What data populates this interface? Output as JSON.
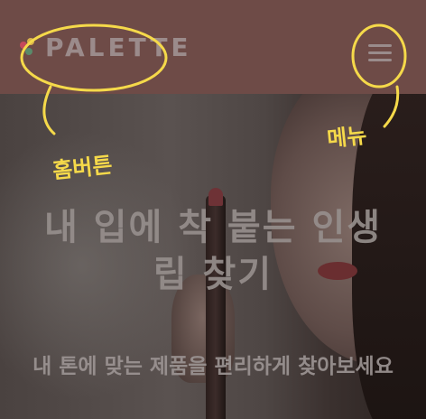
{
  "header": {
    "logo_text": "PALETTE",
    "menu_icon": "hamburger-menu-icon",
    "background": "#6e4b47"
  },
  "hero": {
    "title_line1": "내 입에 착 붙는 인생",
    "title_line2": "립 찾기",
    "subtitle": "내 톤에 맞는 제품을 편리하게 찾아보세요"
  },
  "annotations": {
    "home_label": "홈버튼",
    "menu_label": "메뉴",
    "highlight_color": "#f5d94a"
  }
}
